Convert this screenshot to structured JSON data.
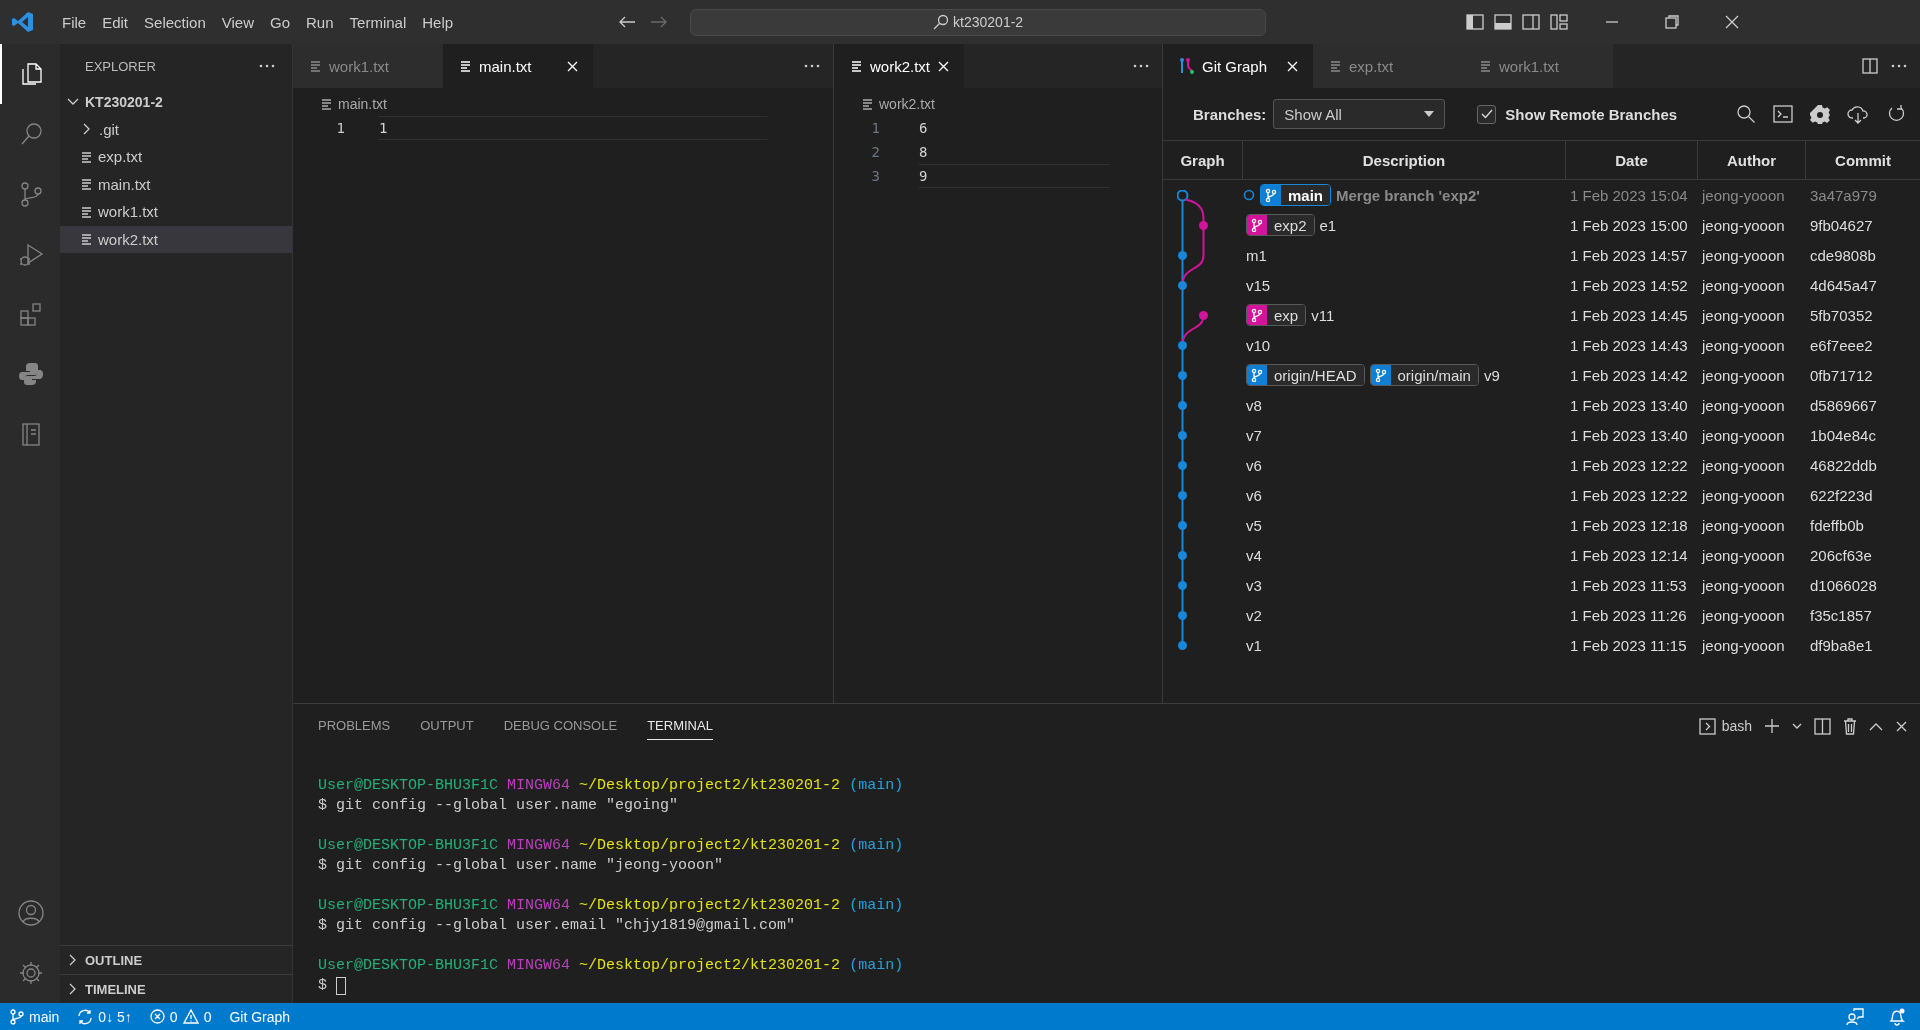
{
  "title_bar": {
    "menu": [
      "File",
      "Edit",
      "Selection",
      "View",
      "Go",
      "Run",
      "Terminal",
      "Help"
    ],
    "search": "kt230201-2"
  },
  "activity_bar": [
    {
      "kind": "files",
      "selected": true
    },
    {
      "kind": "search",
      "selected": false
    },
    {
      "kind": "source-control",
      "selected": false
    },
    {
      "kind": "run",
      "selected": false
    },
    {
      "kind": "extensions",
      "selected": false
    },
    {
      "kind": "blocks",
      "selected": false
    },
    {
      "kind": "notebook",
      "selected": false
    }
  ],
  "explorer": {
    "title": "EXPLORER",
    "root": {
      "label": "KT230201-2",
      "expanded": true,
      "children": [
        {
          "label": ".git",
          "kind": "folder",
          "expanded": false,
          "selected": false
        },
        {
          "label": "exp.txt",
          "kind": "file",
          "selected": false
        },
        {
          "label": "main.txt",
          "kind": "file",
          "selected": false
        },
        {
          "label": "work1.txt",
          "kind": "file",
          "selected": false
        },
        {
          "label": "work2.txt",
          "kind": "file",
          "selected": true
        }
      ]
    },
    "sections": [
      {
        "label": "OUTLINE",
        "expanded": false
      },
      {
        "label": "TIMELINE",
        "expanded": false
      }
    ]
  },
  "editor_groups": [
    {
      "focused": true,
      "tabs": [
        {
          "label": "work1.txt",
          "selected": false
        },
        {
          "label": "main.txt",
          "selected": true
        }
      ],
      "breadcrumb": "main.txt",
      "lines": [
        {
          "number": "1",
          "text": "1",
          "current": true
        }
      ]
    },
    {
      "focused": false,
      "tabs": [
        {
          "label": "work2.txt",
          "selected": true
        }
      ],
      "breadcrumb": "work2.txt",
      "lines": [
        {
          "number": "1",
          "text": "6",
          "current": false
        },
        {
          "number": "2",
          "text": "8",
          "current": false
        },
        {
          "number": "3",
          "text": "9",
          "current": true
        }
      ]
    }
  ],
  "git_graph": {
    "tabs": [
      {
        "label": "Git Graph",
        "kind": "git-graph",
        "selected": true
      },
      {
        "label": "exp.txt",
        "kind": "file",
        "selected": false
      },
      {
        "label": "work1.txt",
        "kind": "file",
        "selected": false
      }
    ],
    "branches_label": "Branches:",
    "branch_filter": "Show All",
    "show_remote": {
      "label": "Show Remote Branches",
      "checked": true
    },
    "columns": [
      "Graph",
      "Description",
      "Date",
      "Author",
      "Commit"
    ],
    "commits": [
      {
        "kind": "head",
        "refs": [
          {
            "name": "main",
            "color": "#0f7fd4"
          }
        ],
        "message": "Merge branch 'exp2'",
        "date": "1 Feb 2023 15:04",
        "author": "jeong-yooon",
        "hash": "3a47a979"
      },
      {
        "kind": "side",
        "refs": [
          {
            "name": "exp2",
            "color": "#d3139b"
          }
        ],
        "message": "e1",
        "date": "1 Feb 2023 15:00",
        "author": "jeong-yooon",
        "hash": "9fb04627"
      },
      {
        "kind": "main",
        "message": "m1",
        "date": "1 Feb 2023 14:57",
        "author": "jeong-yooon",
        "hash": "cde9808b"
      },
      {
        "kind": "main",
        "message": "v15",
        "date": "1 Feb 2023 14:52",
        "author": "jeong-yooon",
        "hash": "4d645a47"
      },
      {
        "kind": "side",
        "refs": [
          {
            "name": "exp",
            "color": "#d3139b"
          }
        ],
        "message": "v11",
        "date": "1 Feb 2023 14:45",
        "author": "jeong-yooon",
        "hash": "5fb70352"
      },
      {
        "kind": "main",
        "message": "v10",
        "date": "1 Feb 2023 14:43",
        "author": "jeong-yooon",
        "hash": "e6f7eee2"
      },
      {
        "kind": "main",
        "refs": [
          {
            "name": "origin/HEAD",
            "color": "#0f7fd4"
          },
          {
            "name": "origin/main",
            "color": "#0f7fd4"
          }
        ],
        "message": "v9",
        "date": "1 Feb 2023 14:42",
        "author": "jeong-yooon",
        "hash": "0fb71712"
      },
      {
        "kind": "main",
        "message": "v8",
        "date": "1 Feb 2023 13:40",
        "author": "jeong-yooon",
        "hash": "d5869667"
      },
      {
        "kind": "main",
        "message": "v7",
        "date": "1 Feb 2023 13:40",
        "author": "jeong-yooon",
        "hash": "1b04e84c"
      },
      {
        "kind": "main",
        "message": "v6",
        "date": "1 Feb 2023 12:22",
        "author": "jeong-yooon",
        "hash": "46822ddb"
      },
      {
        "kind": "main",
        "message": "v6",
        "date": "1 Feb 2023 12:22",
        "author": "jeong-yooon",
        "hash": "622f223d"
      },
      {
        "kind": "main",
        "message": "v5",
        "date": "1 Feb 2023 12:18",
        "author": "jeong-yooon",
        "hash": "fdeffb0b"
      },
      {
        "kind": "main",
        "message": "v4",
        "date": "1 Feb 2023 12:14",
        "author": "jeong-yooon",
        "hash": "206cf63e"
      },
      {
        "kind": "main",
        "message": "v3",
        "date": "1 Feb 2023 11:53",
        "author": "jeong-yooon",
        "hash": "d1066028"
      },
      {
        "kind": "main",
        "message": "v2",
        "date": "1 Feb 2023 11:26",
        "author": "jeong-yooon",
        "hash": "f35c1857"
      },
      {
        "kind": "main",
        "message": "v1",
        "date": "1 Feb 2023 11:15",
        "author": "jeong-yooon",
        "hash": "df9ba8e1"
      }
    ]
  },
  "panel": {
    "tabs": [
      {
        "label": "PROBLEMS",
        "selected": false
      },
      {
        "label": "OUTPUT",
        "selected": false
      },
      {
        "label": "DEBUG CONSOLE",
        "selected": false
      },
      {
        "label": "TERMINAL",
        "selected": true
      }
    ],
    "terminal_name": "bash",
    "terminal": [
      {
        "user": "User@DESKTOP-BHU3F1C",
        "shell": "MINGW64",
        "path": "~/Desktop/project2/kt230201-2",
        "branch": "(main)",
        "command": "$ git config --global user.name \"egoing\"",
        "cursor": false
      },
      {
        "user": "User@DESKTOP-BHU3F1C",
        "shell": "MINGW64",
        "path": "~/Desktop/project2/kt230201-2",
        "branch": "(main)",
        "command": "$ git config --global user.name \"jeong-yooon\"",
        "cursor": false
      },
      {
        "user": "User@DESKTOP-BHU3F1C",
        "shell": "MINGW64",
        "path": "~/Desktop/project2/kt230201-2",
        "branch": "(main)",
        "command": "$ git config --global user.email \"chjy1819@gmail.com\"",
        "cursor": false
      },
      {
        "user": "User@DESKTOP-BHU3F1C",
        "shell": "MINGW64",
        "path": "~/Desktop/project2/kt230201-2",
        "branch": "(main)",
        "command": "$",
        "cursor": true
      }
    ]
  },
  "status_bar": [
    {
      "kind": "branch",
      "text": "main"
    },
    {
      "kind": "sync",
      "text": "0↓ 5↑"
    },
    {
      "kind": "problems",
      "errors": "0",
      "warnings": "0"
    },
    {
      "kind": "text",
      "text": "Git Graph"
    }
  ]
}
